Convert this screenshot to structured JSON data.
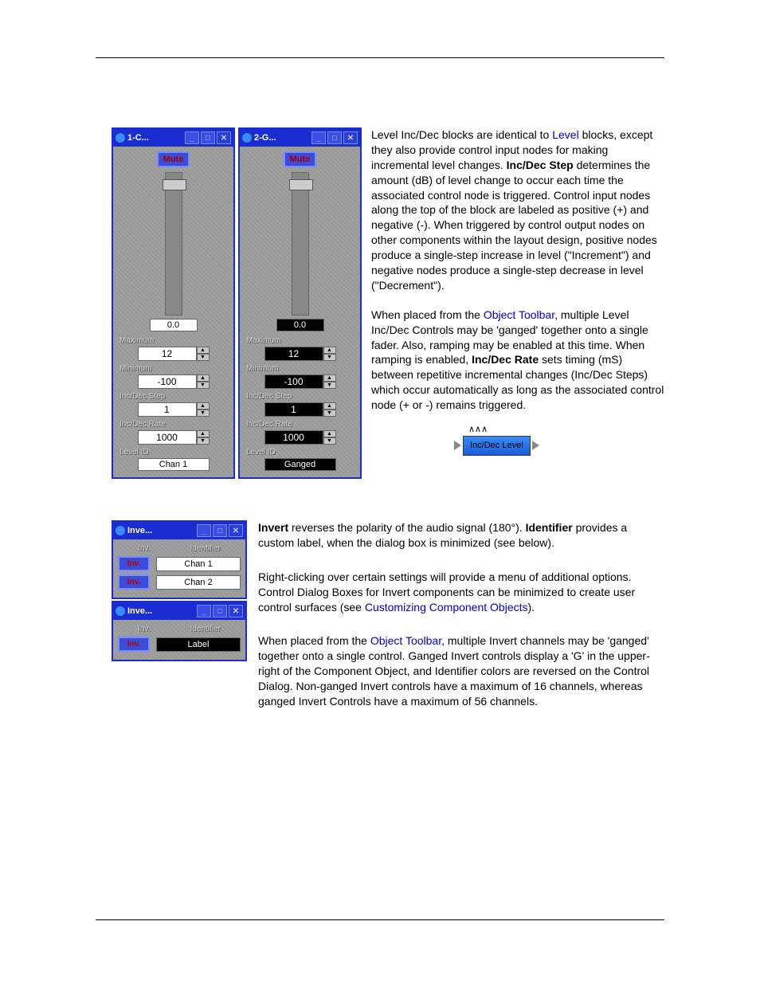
{
  "levelPanels": [
    {
      "title": "1-C...",
      "dark": false,
      "mute": "Mute",
      "readout": "0.0",
      "max_label": "Maximum",
      "max": "12",
      "min_label": "Minimum",
      "min": "-100",
      "step_label": "Inc/Dec Step",
      "step": "1",
      "rate_label": "Inc/Dec Rate",
      "rate": "1000",
      "id_label": "Level ID",
      "id": "Chan 1"
    },
    {
      "title": "2-G...",
      "dark": true,
      "mute": "Mute",
      "readout": "0.0",
      "max_label": "Maximum",
      "max": "12",
      "min_label": "Minimum",
      "min": "-100",
      "step_label": "Inc/Dec Step",
      "step": "1",
      "rate_label": "Inc/Dec Rate",
      "rate": "1000",
      "id_label": "Level ID",
      "id": "Ganged"
    }
  ],
  "para1": {
    "a": "Level Inc/Dec blocks are identical to ",
    "link1": "Level",
    "b": " blocks, except they also provide control input nodes for making incremental level changes. ",
    "step_label": "Inc/Dec Step",
    "c": " determines the amount (dB) of level change to occur each time the associated control node is triggered. Control input nodes along the top of the block are labeled as positive (+) and negative (-). When triggered by control output nodes on other components within the layout design, positive nodes produce a single-step increase in level (\"Increment\") and negative nodes produce a single-step decrease in level (\"Decrement\")."
  },
  "para2": {
    "a": "When placed from the ",
    "link1": "Object Toolbar",
    "b": ", multiple Level Inc/Dec Controls may be 'ganged' together onto a single fader. Also, ramping may be enabled at this time. When ramping is enabled, ",
    "rate_label": "Inc/Dec Rate",
    "c": " sets timing (mS) between repetitive incremental changes (Inc/Dec Steps) which occur automatically as long as the associated control node (+ or -) remains triggered."
  },
  "block": {
    "nodes": "∧∧∧",
    "label": "Inc/Dec Level"
  },
  "invertPanels": [
    {
      "title": "Inve...",
      "dark": false,
      "hdr_inv": "Inv.",
      "hdr_id": "Identifier",
      "rows": [
        {
          "btn": "Inv.",
          "id": "Chan 1"
        },
        {
          "btn": "Inv.",
          "id": "Chan 2"
        }
      ]
    },
    {
      "title": "Inve...",
      "dark": true,
      "hdr_inv": "Inv.",
      "hdr_id": "Identifier",
      "rows": [
        {
          "btn": "Inv.",
          "id": "Label"
        }
      ]
    }
  ],
  "para3": {
    "invert": "Invert",
    "a": " reverses the polarity of the audio signal (180°). ",
    "ident": "Identifier",
    "b": " provides a custom label, when the dialog box is minimized (see below)."
  },
  "para4": {
    "a": "Right-clicking over certain settings will provide a menu of additional options. Control Dialog Boxes for Invert components can be minimized to create user control surfaces (see ",
    "link1": "Customizing Component Objects",
    "b": ")."
  },
  "para5": {
    "a": "When placed from the ",
    "link1": "Object Toolbar",
    "b": ", multiple Invert channels may be 'ganged' together onto a single control. Ganged Invert controls display a 'G' in the upper-right of the Component Object, and Identifier colors are reversed on the Control Dialog. Non-ganged Invert controls have a maximum of 16 channels, whereas ganged Invert Controls have a maximum of 56 channels."
  }
}
